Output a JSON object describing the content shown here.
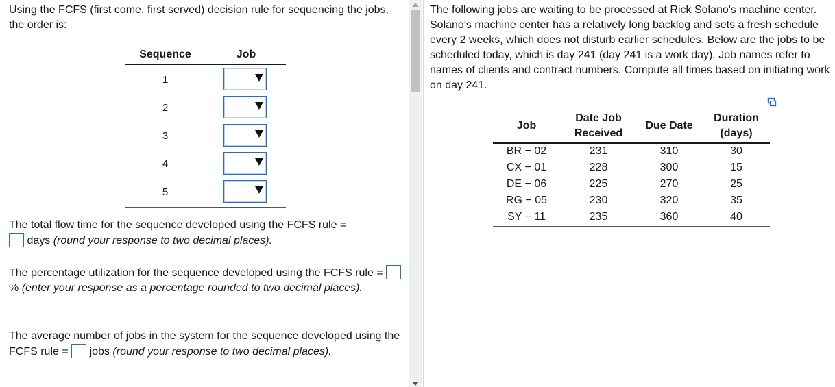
{
  "left": {
    "intro": "Using the FCFS (first come, first served) decision rule for sequencing the jobs, the order is:",
    "seq_table": {
      "headers": [
        "Sequence",
        "Job"
      ],
      "rows": [
        "1",
        "2",
        "3",
        "4",
        "5"
      ]
    },
    "q1": {
      "text": "The total flow time for the sequence developed using the FCFS rule =",
      "after": "days",
      "hint": "(round your response to two decimal places)."
    },
    "q2": {
      "text": "The percentage utilization for the sequence developed using the FCFS rule =",
      "after": "%",
      "hint": "(enter your response as a percentage rounded to two decimal places)."
    },
    "q3": {
      "text": "The average number of jobs in the system for the sequence developed using the FCFS rule =",
      "after": "jobs",
      "hint": "(round your response to two decimal places)."
    }
  },
  "right": {
    "text": "The following jobs are waiting to be processed at Rick Solano's machine center. Solano's machine center has a relatively long backlog and sets a fresh schedule every 2 weeks, which does not disturb earlier schedules. Below are the jobs to be scheduled today, which is day 241 (day 241 is a work day). Job names refer to names of clients and contract numbers. Compute all times based on initiating work on day 241.",
    "table": {
      "headers": {
        "job": "Job",
        "date_line1": "Date Job",
        "date_line2": "Received",
        "due": "Due Date",
        "dur_line1": "Duration",
        "dur_line2": "(days)"
      },
      "rows": [
        {
          "job": "BR − 02",
          "received": "231",
          "due": "310",
          "duration": "30"
        },
        {
          "job": "CX − 01",
          "received": "228",
          "due": "300",
          "duration": "15"
        },
        {
          "job": "DE − 06",
          "received": "225",
          "due": "270",
          "duration": "25"
        },
        {
          "job": "RG − 05",
          "received": "230",
          "due": "320",
          "duration": "35"
        },
        {
          "job": "SY − 11",
          "received": "235",
          "due": "360",
          "duration": "40"
        }
      ]
    }
  },
  "colors": {
    "input_border": "#2b6fc0",
    "text": "#1a1a1a"
  }
}
